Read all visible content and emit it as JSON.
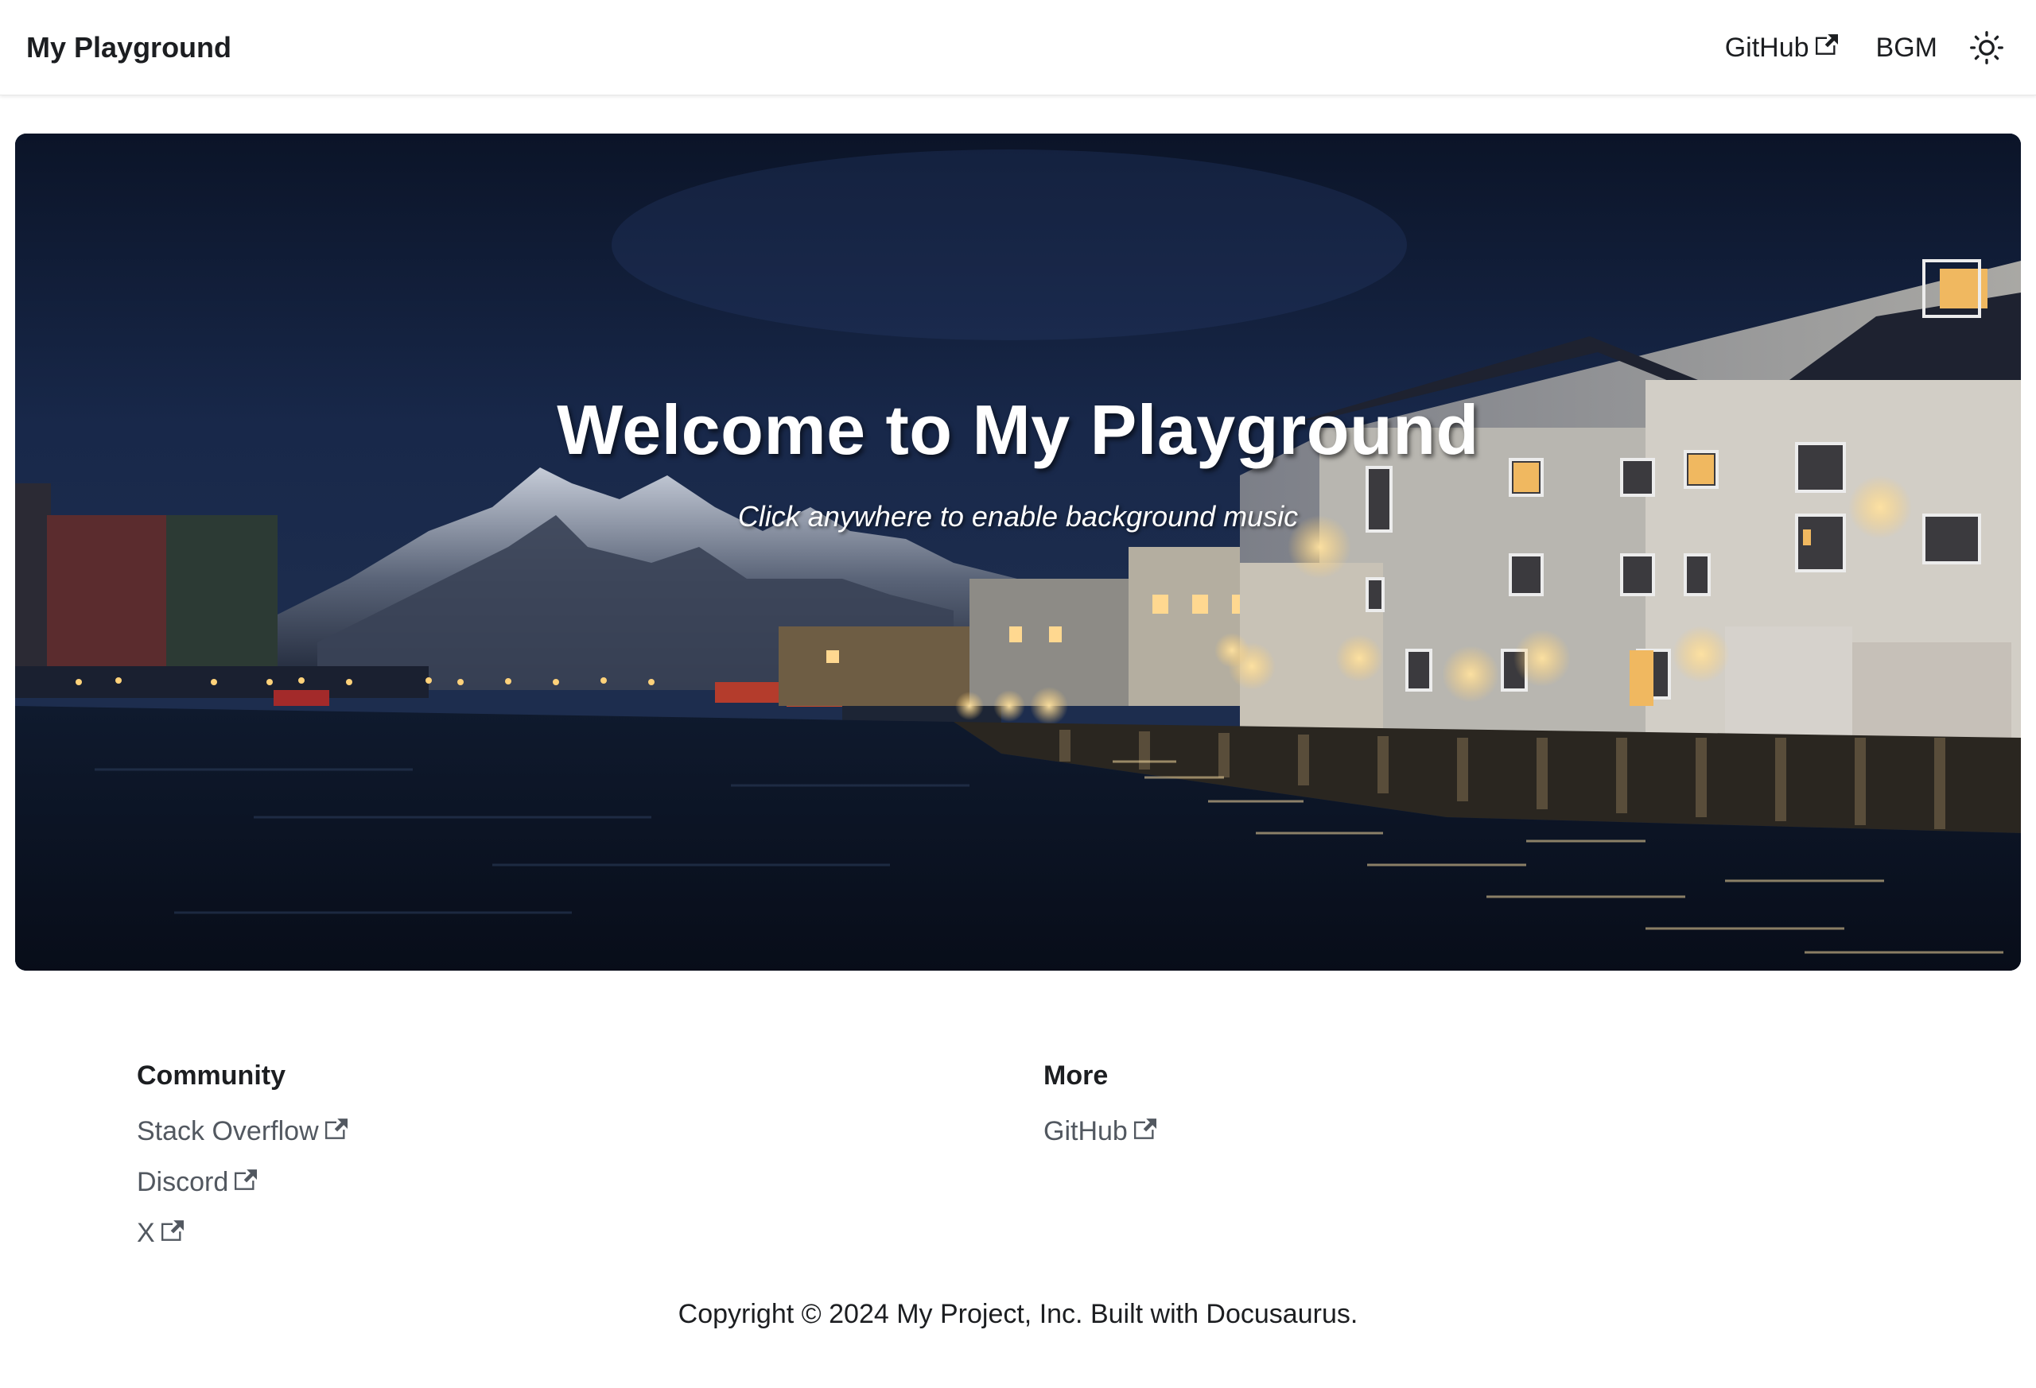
{
  "navbar": {
    "brand": "My Playground",
    "links": {
      "github": "GitHub",
      "bgm": "BGM"
    },
    "theme_icon": "sun-icon"
  },
  "hero": {
    "title": "Welcome to My Playground",
    "subtitle": "Click anywhere to enable background music",
    "image_description_icon": "harbor-night-scene"
  },
  "footer": {
    "columns": [
      {
        "title": "Community",
        "links": [
          "Stack Overflow",
          "Discord",
          "X"
        ]
      },
      {
        "title": "More",
        "links": [
          "GitHub"
        ]
      }
    ],
    "copyright": "Copyright © 2024 My Project, Inc. Built with Docusaurus."
  },
  "colors": {
    "navbar_bg": "#ffffff",
    "text_primary": "#1c1e21",
    "link_secondary": "#525860",
    "hero_sky": "#0c1426"
  }
}
